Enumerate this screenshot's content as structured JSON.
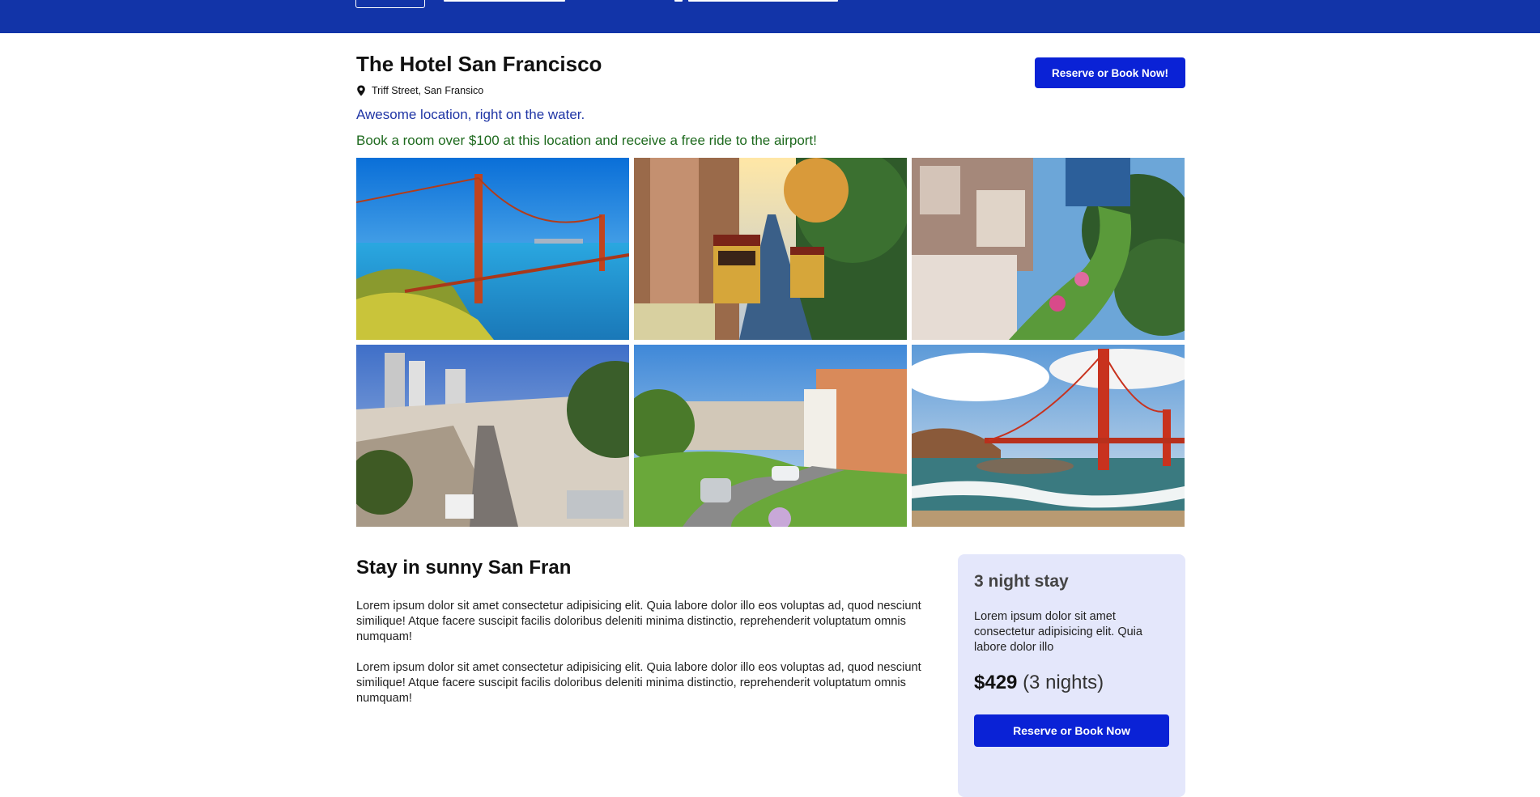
{
  "colors": {
    "nav_bg": "#1234a8",
    "primary_button": "#0a22d6",
    "tagline": "#1f35a5",
    "promo": "#1e6a1e",
    "card_bg": "#e4e7fb"
  },
  "hotel": {
    "name": "The Hotel San Francisco",
    "address": "Triff Street, San Fransico",
    "address_icon": "map-pin-icon",
    "tagline": "Awesome location, right on the water.",
    "promo": "Book a room over $100 at this location and receive a free ride to the airport!",
    "reserve_button": "Reserve or Book Now!"
  },
  "gallery": [
    {
      "subject": "golden-gate-bridge-aerial"
    },
    {
      "subject": "cable-cars-on-street"
    },
    {
      "subject": "lombard-street-gardens"
    },
    {
      "subject": "steep-street-view"
    },
    {
      "subject": "lombard-street-drive"
    },
    {
      "subject": "golden-gate-bridge-beach"
    }
  ],
  "content": {
    "heading": "Stay in sunny San Fran",
    "paragraph1": "Lorem ipsum dolor sit amet consectetur adipisicing elit. Quia labore dolor illo eos voluptas ad, quod nesciunt similique! Atque facere suscipit facilis doloribus deleniti minima distinctio, reprehenderit voluptatum omnis numquam!",
    "paragraph2": "Lorem ipsum dolor sit amet consectetur adipisicing elit. Quia labore dolor illo eos voluptas ad, quod nesciunt similique! Atque facere suscipit facilis doloribus deleniti minima distinctio, reprehenderit voluptatum omnis numquam!"
  },
  "booking_card": {
    "title": "3 night stay",
    "text": "Lorem ipsum dolor sit amet consectetur adipisicing elit. Quia labore dolor illo",
    "price": "$429",
    "nights": "(3 nights)",
    "button": "Reserve or Book Now"
  }
}
